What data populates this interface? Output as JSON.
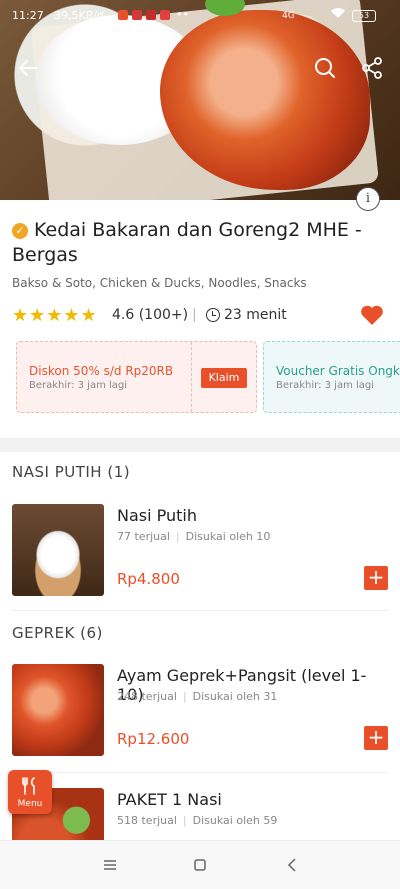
{
  "status_bar": {
    "time": "11:27",
    "network_speed": "39,5KB/d",
    "more": "••",
    "signal": "4G",
    "battery": "53"
  },
  "store": {
    "name": "Kedai Bakaran dan Goreng2 MHE - Bergas",
    "categories": "Bakso & Soto, Chicken & Ducks, Noodles, Snacks",
    "rating": "4.6 (100+)",
    "stars": "★★★★★",
    "eta": "23 menit"
  },
  "promos": [
    {
      "title": "Diskon 50% s/d Rp20RB",
      "expiry": "Berakhir: 3 jam lagi",
      "action": "Klaim"
    },
    {
      "title": "Voucher Gratis Ongkir",
      "expiry": "Berakhir: 3 jam lagi"
    }
  ],
  "sections": [
    {
      "title": "NASI PUTIH (1)"
    },
    {
      "title": "GEPREK (6)"
    }
  ],
  "items": [
    {
      "name": "Nasi Putih",
      "sold": "77 terjual",
      "liked": "Disukai oleh 10",
      "price": "Rp4.800"
    },
    {
      "name": "Ayam Geprek+Pangsit (level 1-10)",
      "sold": "248 terjual",
      "liked": "Disukai oleh 31",
      "price": "Rp12.600"
    },
    {
      "name": "PAKET 1 Nasi",
      "sold": "518 terjual",
      "liked": "Disukai oleh 59"
    }
  ],
  "menu_button": {
    "label": "Menu"
  },
  "colors": {
    "accent": "#e8502a",
    "star": "#f5b800",
    "voucher": "#2a9d8f",
    "badge": "#f0a523"
  },
  "icons": [
    "back-arrow-icon",
    "search-icon",
    "share-icon",
    "info-icon",
    "verified-badge-icon",
    "clock-icon",
    "heart-icon",
    "plus-icon",
    "utensils-icon",
    "recents-icon",
    "home-icon",
    "nav-back-icon"
  ]
}
